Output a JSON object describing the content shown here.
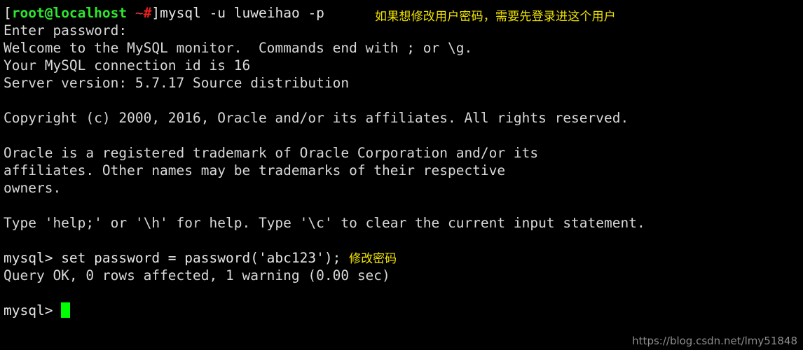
{
  "terminal": {
    "background_color": "#000000",
    "foreground_color": "#d8d8d8",
    "cursor_color": "#00ff00",
    "accent_prompt_color": "#2ee62e",
    "accent_hash_color": "#f02020",
    "annotation_color": "#f2e500"
  },
  "prompt": {
    "bracket_open": "[",
    "user_host": "root@localhost",
    "space": " ",
    "tilde": "~",
    "hash": "#",
    "bracket_close": "]",
    "command": "mysql -u luweihao -p"
  },
  "annotations": {
    "top_note": "如果想修改用户密码，需要先登录进这个用户",
    "inline_note": "修改密码"
  },
  "lines": {
    "enter_password": "Enter password:",
    "welcome": "Welcome to the MySQL monitor.  Commands end with ; or \\g.",
    "connection_id": "Your MySQL connection id is 16",
    "server_version": "Server version: 5.7.17 Source distribution",
    "copyright": "Copyright (c) 2000, 2016, Oracle and/or its affiliates. All rights reserved.",
    "trademark_1": "Oracle is a registered trademark of Oracle Corporation and/or its",
    "trademark_2": "affiliates. Other names may be trademarks of their respective",
    "trademark_3": "owners.",
    "help_hint": "Type 'help;' or '\\h' for help. Type '\\c' to clear the current input statement.",
    "mysql_prompt": "mysql> ",
    "set_password_cmd": "set password = password('abc123'); ",
    "query_ok": "Query OK, 0 rows affected, 1 warning (0.00 sec)",
    "final_prompt": "mysql> "
  },
  "watermark": {
    "text": "https://blog.csdn.net/lmy51848"
  }
}
